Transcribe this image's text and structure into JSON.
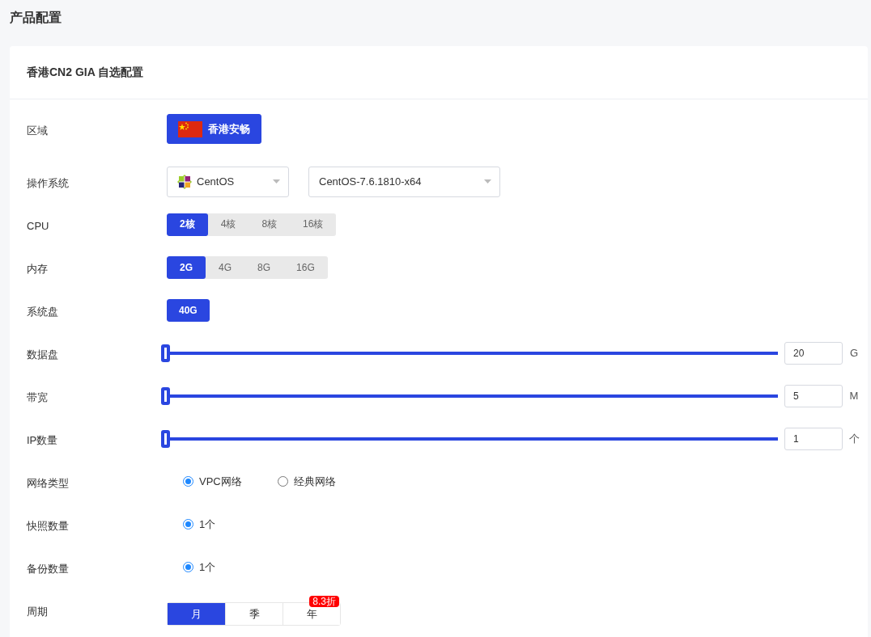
{
  "page_title": "产品配置",
  "card_title": "香港CN2 GIA 自选配置",
  "rows": [
    {
      "kind": "region",
      "label": "区域",
      "options": [
        {
          "text": "香港安畅",
          "selected": true
        }
      ]
    },
    {
      "kind": "selects",
      "label": "操作系统",
      "selects": [
        {
          "kind": "logo",
          "value": "CentOS"
        },
        {
          "kind": "plain",
          "value": "CentOS-7.6.1810-x64"
        }
      ]
    },
    {
      "kind": "segments",
      "label": "CPU",
      "options": [
        {
          "text": "2核",
          "selected": true
        },
        {
          "text": "4核",
          "selected": false
        },
        {
          "text": "8核",
          "selected": false
        },
        {
          "text": "16核",
          "selected": false
        }
      ]
    },
    {
      "kind": "segments",
      "label": "内存",
      "options": [
        {
          "text": "2G",
          "selected": true
        },
        {
          "text": "4G",
          "selected": false
        },
        {
          "text": "8G",
          "selected": false
        },
        {
          "text": "16G",
          "selected": false
        }
      ]
    },
    {
      "kind": "segments",
      "label": "系统盘",
      "options": [
        {
          "text": "40G",
          "selected": true
        }
      ]
    },
    {
      "kind": "slider",
      "label": "数据盘",
      "level": 0,
      "value": "20",
      "unit": "G"
    },
    {
      "kind": "slider",
      "label": "带宽",
      "level": 0,
      "value": "5",
      "unit": "M"
    },
    {
      "kind": "slider",
      "label": "IP数量",
      "level": 0,
      "value": "1",
      "unit": "个"
    },
    {
      "kind": "radios",
      "label": "网络类型",
      "options": [
        {
          "text": "VPC网络",
          "selected": true
        },
        {
          "text": "经典网络",
          "selected": false
        }
      ]
    },
    {
      "kind": "radios",
      "label": "快照数量",
      "options": [
        {
          "text": "1个",
          "selected": true
        }
      ]
    },
    {
      "kind": "radios",
      "label": "备份数量",
      "options": [
        {
          "text": "1个",
          "selected": true
        }
      ]
    },
    {
      "kind": "tabs",
      "label": "周期",
      "options": [
        {
          "text": "月",
          "selected": true
        },
        {
          "text": "季",
          "selected": false
        },
        {
          "text": "年",
          "selected": false,
          "badge": "8.3折"
        }
      ]
    }
  ]
}
